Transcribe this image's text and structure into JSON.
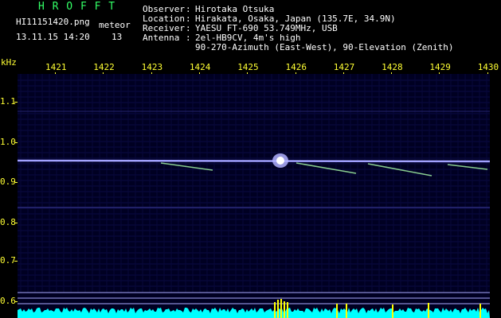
{
  "header": {
    "app_title": "H R O F F T",
    "filename": "HI11151420.png",
    "counter_label": "meteor",
    "datetime": "13.11.15 14:20",
    "counter_value": "13",
    "observer_label": "Observer",
    "observer_value": "Hirotaka Otsuka",
    "location_label": "Location",
    "location_value": "Hirakata, Osaka, Japan (135.7E, 34.9N)",
    "receiver_label": "Receiver",
    "receiver_value": "YAESU FT-690 53.749MHz, USB",
    "antenna_label": "Antenna",
    "antenna_value": "2el-HB9CV, 4m's high",
    "antenna_value2": "90-270-Azimuth (East-West), 90-Elevation (Zenith)",
    "sep": ":"
  },
  "axis": {
    "unit": "kHz",
    "time_ticks": [
      "1421",
      "1422",
      "1423",
      "1424",
      "1425",
      "1426",
      "1427",
      "1428",
      "1429",
      "1430"
    ],
    "freq_ticks": [
      "1.1",
      "1.0",
      "0.9",
      "0.8",
      "0.7",
      "0.6"
    ]
  },
  "colors": {
    "background": "#000022",
    "carrier": "#8888ff",
    "echo": "#aaffaa",
    "baseline": "#00ffff",
    "peak": "#ffff00",
    "label": "#ffff33"
  }
}
